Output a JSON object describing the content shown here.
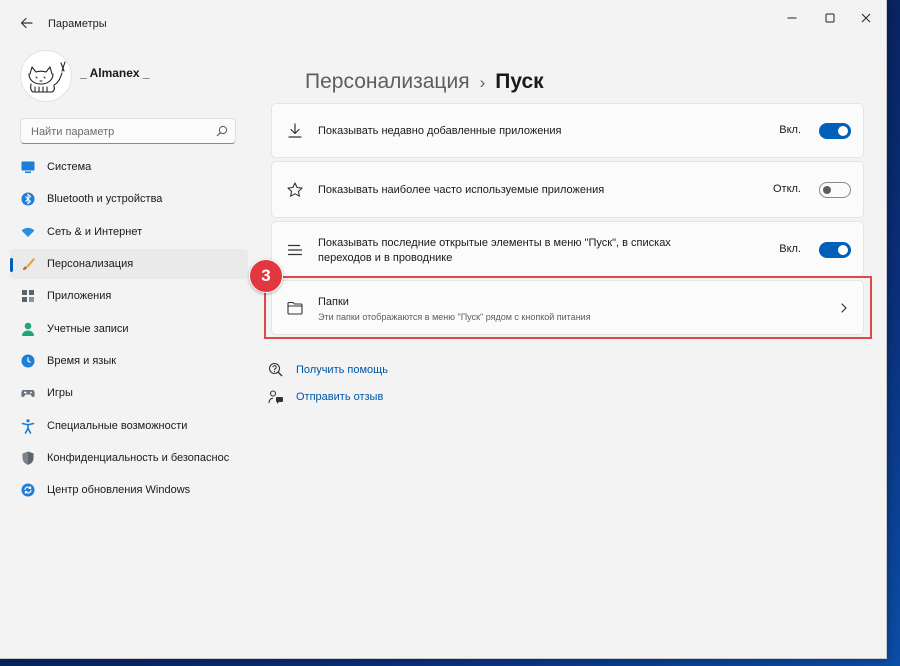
{
  "window": {
    "title": "Параметры",
    "back_icon": "back-arrow-icon",
    "controls": [
      "minimize-icon",
      "maximize-icon",
      "close-icon"
    ]
  },
  "profile": {
    "username": "_ Almanex _",
    "avatar_icon": "cat-avatar-icon"
  },
  "search": {
    "placeholder": "Найти параметр",
    "value": "",
    "icon": "search-icon"
  },
  "sidebar": {
    "items": [
      {
        "label": "Система",
        "icon": "system-icon",
        "active": false
      },
      {
        "label": "Bluetooth и устройства",
        "icon": "bluetooth-icon",
        "active": false
      },
      {
        "label": "Сеть & и Интернет",
        "icon": "network-icon",
        "active": false
      },
      {
        "label": "Персонализация",
        "icon": "brush-icon",
        "active": true
      },
      {
        "label": "Приложения",
        "icon": "apps-icon",
        "active": false
      },
      {
        "label": "Учетные записи",
        "icon": "account-icon",
        "active": false
      },
      {
        "label": "Время и язык",
        "icon": "time-language-icon",
        "active": false
      },
      {
        "label": "Игры",
        "icon": "gaming-icon",
        "active": false
      },
      {
        "label": "Специальные возможности",
        "icon": "accessibility-icon",
        "active": false
      },
      {
        "label": "Конфиденциальность и безопаснос",
        "icon": "privacy-shield-icon",
        "active": false
      },
      {
        "label": "Центр обновления Windows",
        "icon": "windows-update-icon",
        "active": false
      }
    ]
  },
  "main": {
    "breadcrumb_parent": "Персонализация",
    "breadcrumb_separator": "›",
    "breadcrumb_current": "Пуск",
    "settings": [
      {
        "label": "Показывать недавно добавленные приложения",
        "state_label": "Вкл.",
        "on": true,
        "icon": "download-icon"
      },
      {
        "label": "Показывать наиболее часто используемые приложения",
        "state_label": "Откл.",
        "on": false,
        "icon": "star-icon"
      },
      {
        "label_line1": "Показывать последние открытые элементы в меню \"Пуск\", в списках",
        "label_line2": "переходов и в проводнике",
        "state_label": "Вкл.",
        "on": true,
        "icon": "list-lines-icon"
      }
    ],
    "folders": {
      "title": "Папки",
      "subtitle": "Эти папки отображаются в меню \"Пуск\" рядом с кнопкой питания",
      "icon": "folder-icon",
      "chevron": "chevron-right-icon"
    },
    "step_badge": "3",
    "highlight_color": "#e0474c",
    "links": [
      {
        "label": "Получить помощь",
        "icon": "help-icon"
      },
      {
        "label": "Отправить отзыв",
        "icon": "feedback-icon"
      }
    ]
  },
  "colors": {
    "accent": "#005fb8",
    "badge": "#e0383e",
    "link": "#0055a8"
  }
}
